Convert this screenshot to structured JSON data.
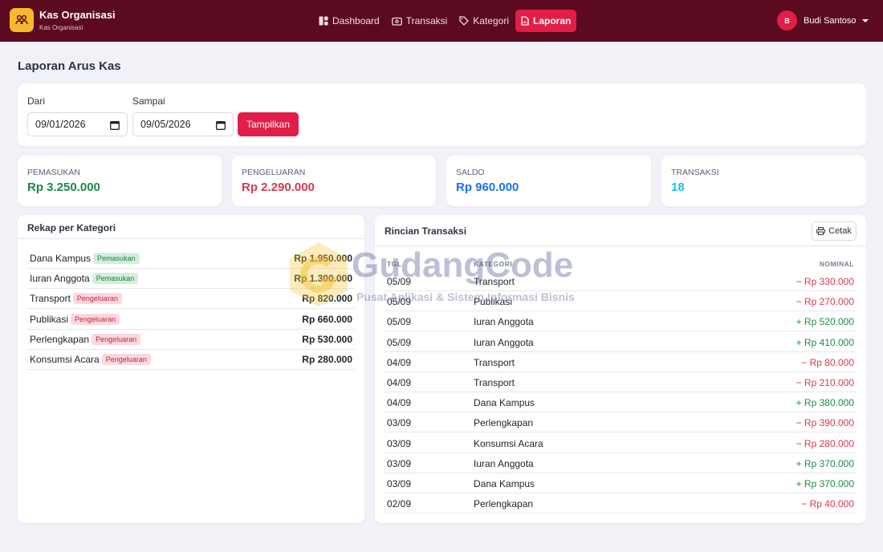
{
  "navbar": {
    "brand_title": "Kas Organisasi",
    "brand_subtitle": "Kas Organisasi",
    "items": [
      {
        "label": "Dashboard",
        "icon": "dashboard-icon",
        "active": false
      },
      {
        "label": "Transaksi",
        "icon": "wallet-icon",
        "active": false
      },
      {
        "label": "Kategori",
        "icon": "tag-icon",
        "active": false
      },
      {
        "label": "Laporan",
        "icon": "report-icon",
        "active": true
      }
    ],
    "user_initial": "B",
    "user_name": "Budi Santoso"
  },
  "page": {
    "title": "Laporan Arus Kas"
  },
  "filter": {
    "from_label": "Dari",
    "from_value": "09/01/2026",
    "to_label": "Sampai",
    "to_value": "09/05/2026",
    "submit_label": "Tampilkan"
  },
  "stats": [
    {
      "label": "PEMASUKAN",
      "value": "Rp 3.250.000",
      "color": "#1e8a4a"
    },
    {
      "label": "PENGELUARAN",
      "value": "Rp 2.290.000",
      "color": "#d63a4f"
    },
    {
      "label": "SALDO",
      "value": "Rp 960.000",
      "color": "#1a73e8"
    },
    {
      "label": "TRANSAKSI",
      "value": "18",
      "color": "#1fc0e0"
    }
  ],
  "rekap": {
    "title": "Rekap per Kategori",
    "rows": [
      {
        "category": "Dana Kampus",
        "type": "Pemasukan",
        "kind": "in",
        "amount": "Rp 1.950.000"
      },
      {
        "category": "Iuran Anggota",
        "type": "Pemasukan",
        "kind": "in",
        "amount": "Rp 1.300.000"
      },
      {
        "category": "Transport",
        "type": "Pengeluaran",
        "kind": "out",
        "amount": "Rp 820.000"
      },
      {
        "category": "Publikasi",
        "type": "Pengeluaran",
        "kind": "out",
        "amount": "Rp 660.000"
      },
      {
        "category": "Perlengkapan",
        "type": "Pengeluaran",
        "kind": "out",
        "amount": "Rp 530.000"
      },
      {
        "category": "Konsumsi Acara",
        "type": "Pengeluaran",
        "kind": "out",
        "amount": "Rp 280.000"
      }
    ]
  },
  "rincian": {
    "title": "Rincian Transaksi",
    "print_label": "Cetak",
    "columns": {
      "date": "TGL",
      "category": "KATEGORI",
      "amount": "NOMINAL"
    },
    "rows": [
      {
        "date": "05/09",
        "category": "Transport",
        "amount": "− Rp 330.000",
        "kind": "out"
      },
      {
        "date": "05/09",
        "category": "Publikasi",
        "amount": "− Rp 270.000",
        "kind": "out"
      },
      {
        "date": "05/09",
        "category": "Iuran Anggota",
        "amount": "+ Rp 520.000",
        "kind": "in"
      },
      {
        "date": "05/09",
        "category": "Iuran Anggota",
        "amount": "+ Rp 410.000",
        "kind": "in"
      },
      {
        "date": "04/09",
        "category": "Transport",
        "amount": "− Rp 80.000",
        "kind": "out"
      },
      {
        "date": "04/09",
        "category": "Transport",
        "amount": "− Rp 210.000",
        "kind": "out"
      },
      {
        "date": "04/09",
        "category": "Dana Kampus",
        "amount": "+ Rp 380.000",
        "kind": "in"
      },
      {
        "date": "03/09",
        "category": "Perlengkapan",
        "amount": "− Rp 390.000",
        "kind": "out"
      },
      {
        "date": "03/09",
        "category": "Konsumsi Acara",
        "amount": "− Rp 280.000",
        "kind": "out"
      },
      {
        "date": "03/09",
        "category": "Iuran Anggota",
        "amount": "+ Rp 370.000",
        "kind": "in"
      },
      {
        "date": "03/09",
        "category": "Dana Kampus",
        "amount": "+ Rp 370.000",
        "kind": "in"
      },
      {
        "date": "02/09",
        "category": "Perlengkapan",
        "amount": "− Rp 40.000",
        "kind": "out"
      }
    ]
  },
  "watermark": {
    "title": "GudangCode",
    "subtitle": "Pusat Aplikasi & Sistem Informasi Bisnis"
  },
  "colors": {
    "navbar": "#5c0a1f",
    "accent": "#e11d48",
    "brand_logo": "#f5b82e",
    "income": "#1e8a4a",
    "expense": "#d63a4f"
  }
}
